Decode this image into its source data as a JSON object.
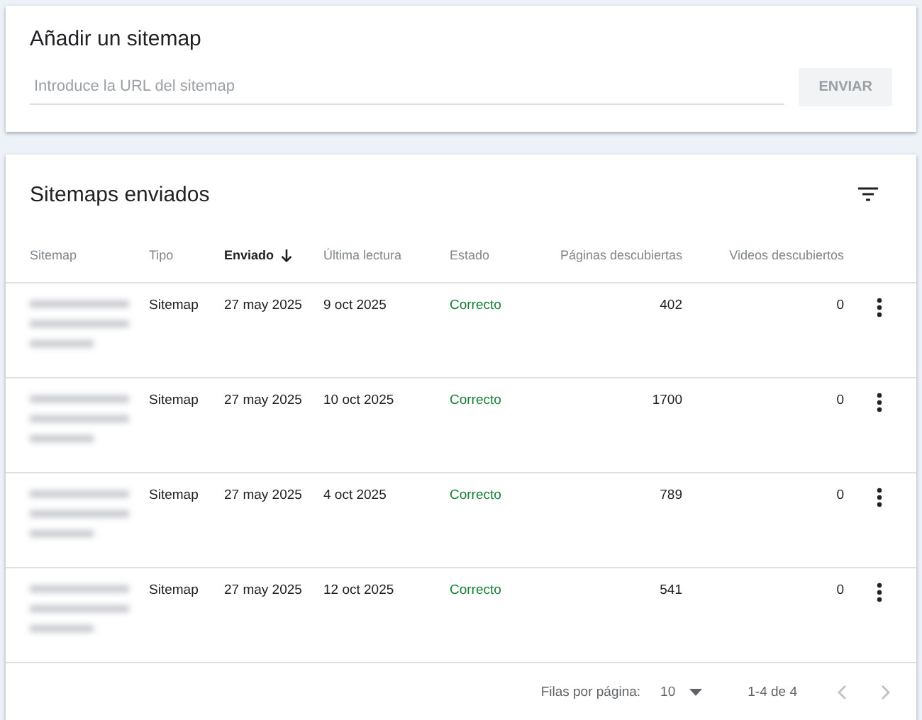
{
  "add_sitemap": {
    "title": "Añadir un sitemap",
    "url_field": {
      "placeholder": "Introduce la URL del sitemap"
    },
    "submit_button": {
      "label": "ENVIAR",
      "disabled": true
    }
  },
  "sitemaps": {
    "title": "Sitemaps enviados",
    "columns": [
      {
        "label": "Sitemap",
        "sorted": false
      },
      {
        "label": "Tipo",
        "sorted": false
      },
      {
        "label": "Enviado",
        "sorted": true
      },
      {
        "label": "Última lectura",
        "sorted": false
      },
      {
        "label": "Estado",
        "sorted": false
      },
      {
        "label": "Páginas descubiertas",
        "sorted": false
      },
      {
        "label": "Videos descubiertos",
        "sorted": false
      }
    ],
    "rows": [
      {
        "type": "Sitemap",
        "submitted": "27 may 2025",
        "last_read": "9 oct 2025",
        "status": "Correcto",
        "pages": "402",
        "videos": "0"
      },
      {
        "type": "Sitemap",
        "submitted": "27 may 2025",
        "last_read": "10 oct 2025",
        "status": "Correcto",
        "pages": "1700",
        "videos": "0"
      },
      {
        "type": "Sitemap",
        "submitted": "27 may 2025",
        "last_read": "4 oct 2025",
        "status": "Correcto",
        "pages": "789",
        "videos": "0"
      },
      {
        "type": "Sitemap",
        "submitted": "27 may 2025",
        "last_read": "12 oct 2025",
        "status": "Correcto",
        "pages": "541",
        "videos": "0"
      }
    ],
    "pagination": {
      "rows_label": "Filas por página:",
      "rows_per_page": "10",
      "range": "1-4 de 4",
      "prev_disabled": true,
      "next_disabled": true
    }
  }
}
